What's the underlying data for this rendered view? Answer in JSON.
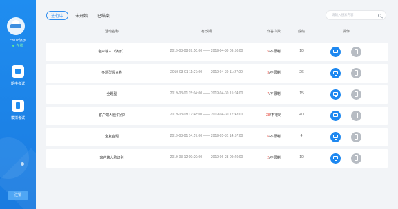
{
  "sidebar": {
    "username": "chu18演示",
    "status": "在线",
    "nav": [
      {
        "label": "期中考试",
        "icon": "monitor-icon"
      },
      {
        "label": "模拟考试",
        "icon": "document-icon"
      }
    ],
    "logout": "注销"
  },
  "tabs": [
    "进行中",
    "未开始",
    "已结束"
  ],
  "search": {
    "placeholder": "请输入搜索内容"
  },
  "table": {
    "headers": [
      "活动名称",
      "有效期",
      "作答次数",
      "成绩",
      "操作"
    ],
    "rows": [
      {
        "name": "客户端人（演示）",
        "period": "2019-03-08 09:50:00 —— 2019-04-30 09:50:00",
        "count_num": "5",
        "count_txt": "/不限制",
        "score": "10"
      },
      {
        "name": "多题型混合卷",
        "period": "2019-03-01 11:27:00 —— 2019-04-30 11:27:00",
        "count_num": "3",
        "count_txt": "/不限制",
        "score": "26"
      },
      {
        "name": "全题型",
        "period": "2019-03-01 15:04:00 —— 2019-04-30 15:04:00",
        "count_num": "7",
        "count_txt": "/不限制",
        "score": "15"
      },
      {
        "name": "客户端人脸识别2",
        "period": "2019-03-08 17:48:00 —— 2019-04-30 17:48:00",
        "count_num": "28",
        "count_txt": "/不限制",
        "score": "40"
      },
      {
        "name": "全复合题",
        "period": "2019-03-01 14:57:00 —— 2019-05-31 14:57:00",
        "count_num": "6",
        "count_txt": "/不限制",
        "score": "4"
      },
      {
        "name": "客户端人脸识别",
        "period": "2019-03-12 09:20:00 —— 2019-06-28 09:20:00",
        "count_num": "2",
        "count_txt": "/不限制",
        "score": "10"
      }
    ]
  },
  "colors": {
    "accent": "#1f8df0",
    "count_red": "#e54d42",
    "doc_btn": "#b7bcc3"
  }
}
